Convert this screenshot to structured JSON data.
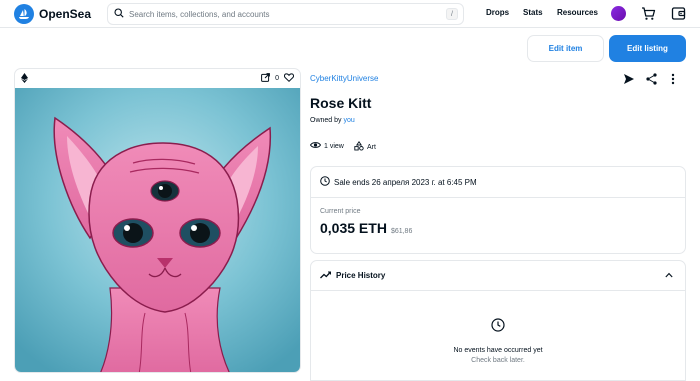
{
  "header": {
    "brand": "OpenSea",
    "search_placeholder": "Search items, collections, and accounts",
    "search_shortcut": "/",
    "nav": [
      "Drops",
      "Stats",
      "Resources"
    ]
  },
  "actions": {
    "edit_item": "Edit item",
    "edit_listing": "Edit listing"
  },
  "card": {
    "favorites_count": "0",
    "chain_icon": "ethereum-icon"
  },
  "item": {
    "collection": "CyberKittyUniverse",
    "name": "Rose Kitt",
    "owned_prefix": "Owned by",
    "owner": "you",
    "views": "1 view",
    "category": "Art"
  },
  "sale": {
    "ends_text": "Sale ends 26 апреля 2023 г. at 6:45 PM",
    "current_price_label": "Current price",
    "price_eth": "0,035 ETH",
    "price_usd": "$61,86"
  },
  "price_history": {
    "title": "Price History",
    "empty_title": "No events have occurred yet",
    "empty_sub": "Check back later."
  },
  "colors": {
    "accent": "#2081e2",
    "text": "#04111d",
    "muted": "#707a83",
    "border": "#e5e8eb"
  }
}
